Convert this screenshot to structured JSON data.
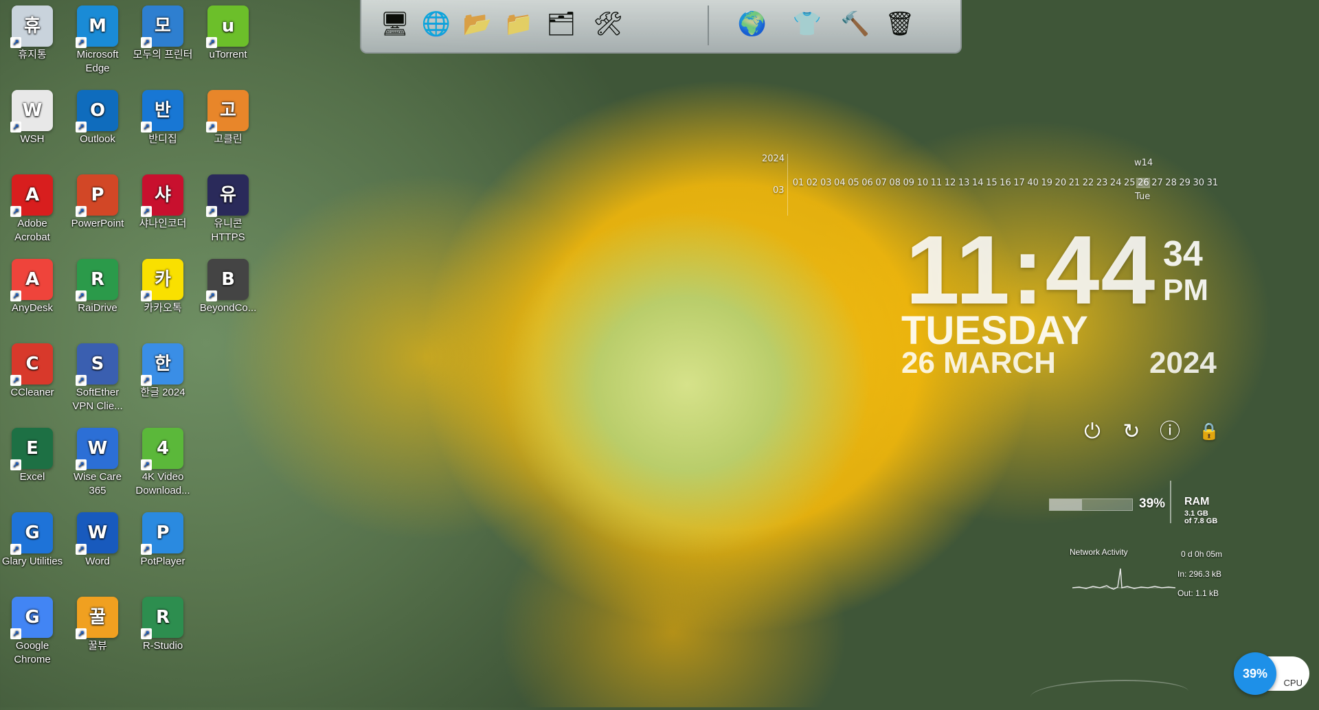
{
  "desktop_icons": [
    {
      "label": "휴지통",
      "icon": "recycle-bin-icon",
      "color": "#c9d3dc"
    },
    {
      "label": "Microsoft Edge",
      "icon": "edge-icon",
      "color": "#1a8bd6"
    },
    {
      "label": "모두의 프린터",
      "icon": "printer-icon",
      "color": "#2e7fd0"
    },
    {
      "label": "uTorrent",
      "icon": "utorrent-icon",
      "color": "#6cbf2a"
    },
    {
      "label": "WSH",
      "icon": "wsh-icon",
      "color": "#e8e8e8"
    },
    {
      "label": "Outlook",
      "icon": "outlook-icon",
      "color": "#0f6cbd"
    },
    {
      "label": "반디집",
      "icon": "bandizip-icon",
      "color": "#1877d4"
    },
    {
      "label": "고클린",
      "icon": "goclean-icon",
      "color": "#e8862a"
    },
    {
      "label": "Adobe Acrobat",
      "icon": "acrobat-icon",
      "color": "#d81e1e"
    },
    {
      "label": "PowerPoint",
      "icon": "powerpoint-icon",
      "color": "#d24726"
    },
    {
      "label": "샤나인코더",
      "icon": "shana-encoder-icon",
      "color": "#c8102e"
    },
    {
      "label": "유니콘 HTTPS",
      "icon": "unicorn-https-icon",
      "color": "#2a2a5a"
    },
    {
      "label": "AnyDesk",
      "icon": "anydesk-icon",
      "color": "#ef443b"
    },
    {
      "label": "RaiDrive",
      "icon": "raidrive-icon",
      "color": "#2b9a4a"
    },
    {
      "label": "카카오톡",
      "icon": "kakaotalk-icon",
      "color": "#f9e000"
    },
    {
      "label": "BeyondCo...",
      "icon": "beyondcompare-icon",
      "color": "#444444"
    },
    {
      "label": "CCleaner",
      "icon": "ccleaner-icon",
      "color": "#d8392b"
    },
    {
      "label": "SoftEther VPN Clie...",
      "icon": "softether-icon",
      "color": "#3a5fb0"
    },
    {
      "label": "한글 2024",
      "icon": "hangul-icon",
      "color": "#3a8ee6"
    },
    {
      "label": "",
      "icon": "",
      "color": ""
    },
    {
      "label": "Excel",
      "icon": "excel-icon",
      "color": "#1d7044"
    },
    {
      "label": "Wise Care 365",
      "icon": "wisecare-icon",
      "color": "#2c6fd6"
    },
    {
      "label": "4K Video Download...",
      "icon": "4k-video-icon",
      "color": "#5bb83a"
    },
    {
      "label": "",
      "icon": "",
      "color": ""
    },
    {
      "label": "Glary Utilities",
      "icon": "glary-icon",
      "color": "#1e73d8"
    },
    {
      "label": "Word",
      "icon": "word-icon",
      "color": "#185abd"
    },
    {
      "label": "PotPlayer",
      "icon": "potplayer-icon",
      "color": "#2a8ae0"
    },
    {
      "label": "",
      "icon": "",
      "color": ""
    },
    {
      "label": "Google Chrome",
      "icon": "chrome-icon",
      "color": "#4285f4"
    },
    {
      "label": "꿀뷰",
      "icon": "honeyview-icon",
      "color": "#f0a020"
    },
    {
      "label": "R-Studio",
      "icon": "rstudio-icon",
      "color": "#2d8e4f"
    }
  ],
  "dock": {
    "items": [
      {
        "name": "dock-system-icon",
        "glyph": "🖥"
      },
      {
        "name": "dock-network-icon",
        "glyph": "🌐"
      },
      {
        "name": "dock-folder-icon",
        "glyph": "📂"
      },
      {
        "name": "dock-folder-green-icon",
        "glyph": "📁"
      },
      {
        "name": "dock-folder-open-icon",
        "glyph": "🗂"
      },
      {
        "name": "dock-tools-icon",
        "glyph": "🛠"
      },
      {
        "name": "dock-globe-icon",
        "glyph": "🌍"
      },
      {
        "name": "dock-tshirt-icon",
        "glyph": "👕"
      },
      {
        "name": "dock-hammer-icon",
        "glyph": "🔨"
      },
      {
        "name": "dock-trash-icon",
        "glyph": "🗑"
      }
    ]
  },
  "calendar": {
    "year": "2024",
    "month": "03",
    "week": "w14",
    "weekday_short": "Tue",
    "days": [
      "01",
      "02",
      "03",
      "04",
      "05",
      "06",
      "07",
      "08",
      "09",
      "10",
      "11",
      "12",
      "13",
      "14",
      "15",
      "16",
      "17",
      "40",
      "19",
      "20",
      "21",
      "22",
      "23",
      "24",
      "25",
      "26",
      "27",
      "28",
      "29",
      "30",
      "31"
    ],
    "today": "26"
  },
  "clock": {
    "time": "11:44",
    "seconds": "34",
    "ampm": "PM",
    "day": "TUESDAY",
    "date": "26 MARCH",
    "year": "2024"
  },
  "power": {
    "shutdown": "⏻",
    "restart": "↻",
    "info": "ⓘ",
    "lock": "🔒"
  },
  "ram": {
    "percent_label": "39%",
    "percent": 39,
    "label": "RAM",
    "used": "3.1 GB",
    "total": "of 7.8 GB"
  },
  "network": {
    "title": "Network Activity",
    "uptime": "0 d 0h 05m",
    "in": "In: 296.3 kB",
    "out": "Out: 1.1 kB"
  },
  "cpu": {
    "percent_label": "39%",
    "label": "CPU"
  }
}
